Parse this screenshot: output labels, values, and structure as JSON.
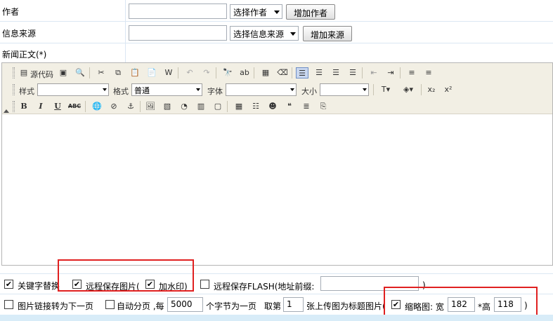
{
  "author": {
    "label": "作者",
    "value": "",
    "select": "选择作者",
    "add_button": "增加作者"
  },
  "source": {
    "label": "信息来源",
    "value": "",
    "select": "选择信息来源",
    "add_button": "增加来源"
  },
  "body_label": "新闻正文(*)",
  "toolbar": {
    "source_code": "源代码",
    "style_label": "样式",
    "style_value": "",
    "format_label": "格式",
    "format_value": "普通",
    "font_label": "字体",
    "font_value": "",
    "size_label": "大小",
    "size_value": "",
    "bold": "B",
    "italic": "I",
    "underline": "U",
    "strike": "ABC",
    "subscript": "x₂",
    "superscript": "x²"
  },
  "options": {
    "keyword_replace": "关键字替换",
    "keyword_replace_checked": true,
    "remote_save_images": "远程保存图片(",
    "remote_save_images_checked": true,
    "watermark": "加水印)",
    "watermark_checked": true,
    "remote_save_flash": "远程保存FLASH(地址前缀:",
    "remote_save_flash_checked": false,
    "flash_prefix_value": "",
    "flash_close": ")",
    "image_link_next": "图片链接转为下一页",
    "image_link_next_checked": false,
    "auto_paging": "自动分页 ,每",
    "auto_paging_checked": false,
    "bytes_per_page": "5000",
    "bytes_suffix": "个字节为一页",
    "take_nth": "取第",
    "take_nth_value": "1",
    "title_image_suffix": "张上传图为标题图片(",
    "thumbnail": "缩略图: 宽",
    "thumbnail_checked": true,
    "thumb_width": "182",
    "height_label": "*高",
    "thumb_height": "118",
    "thumb_close": ")"
  },
  "colors": {
    "highlight_border": "#e02020",
    "row_border": "#dbe7f3",
    "toolbar_bg": "#f2efe4",
    "bottom_bar": "#d8ecf8"
  }
}
